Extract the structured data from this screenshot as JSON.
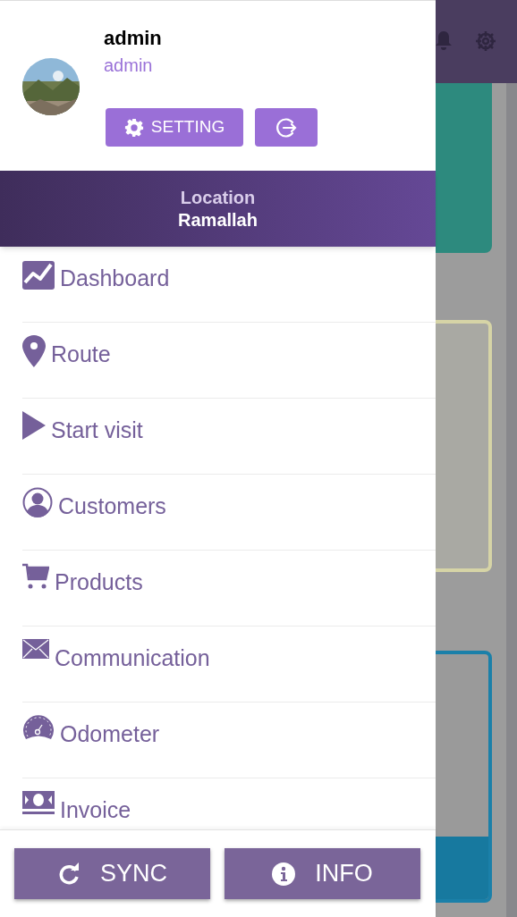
{
  "drawer": {
    "user": {
      "name": "admin",
      "role": "admin"
    },
    "setting_button": {
      "label": "SETTING"
    },
    "location": {
      "label": "Location",
      "value": "Ramallah"
    },
    "menu": [
      {
        "label": "Dashboard"
      },
      {
        "label": "Route"
      },
      {
        "label": "Start visit"
      },
      {
        "label": "Customers"
      },
      {
        "label": "Products"
      },
      {
        "label": "Communication"
      },
      {
        "label": "Odometer"
      },
      {
        "label": "Invoice"
      }
    ],
    "footer_buttons": [
      {
        "kind": "sync",
        "label": "SYNC"
      },
      {
        "kind": "info",
        "label": "INFO"
      }
    ]
  }
}
